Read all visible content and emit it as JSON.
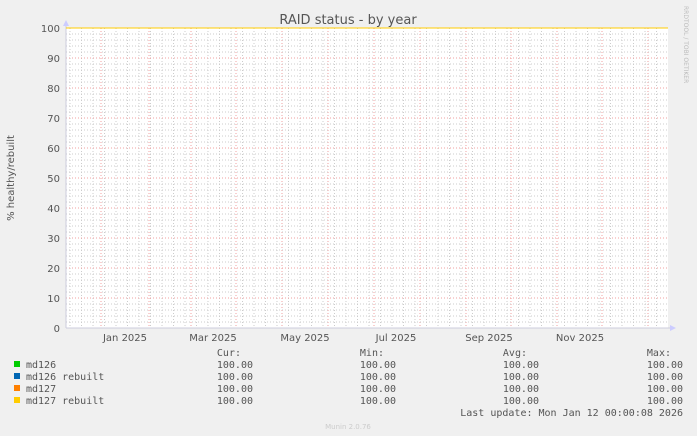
{
  "chart_data": {
    "type": "line",
    "title": "RAID status - by year",
    "ylabel": "% healthy/rebuilt",
    "xlabel": "",
    "ylim": [
      0,
      100
    ],
    "yticks": [
      0,
      10,
      20,
      30,
      40,
      50,
      60,
      70,
      80,
      90,
      100
    ],
    "xticks": [
      "Jan 2025",
      "Mar 2025",
      "May 2025",
      "Jul 2025",
      "Sep 2025",
      "Nov 2025"
    ],
    "grid": true,
    "series": [
      {
        "name": "md126",
        "color": "#00cc00",
        "values": [
          100,
          100
        ]
      },
      {
        "name": "md126 rebuilt",
        "color": "#0066b3",
        "values": [
          100,
          100
        ]
      },
      {
        "name": "md127",
        "color": "#ff8000",
        "values": [
          100,
          100
        ]
      },
      {
        "name": "md127 rebuilt",
        "color": "#ffcc00",
        "values": [
          100,
          100
        ]
      }
    ]
  },
  "legend": {
    "headers": [
      "Cur:",
      "Min:",
      "Avg:",
      "Max:"
    ],
    "rows": [
      {
        "name": "md126",
        "color": "#00cc00",
        "cur": "100.00",
        "min": "100.00",
        "avg": "100.00",
        "max": "100.00"
      },
      {
        "name": "md126 rebuilt",
        "color": "#0066b3",
        "cur": "100.00",
        "min": "100.00",
        "avg": "100.00",
        "max": "100.00"
      },
      {
        "name": "md127",
        "color": "#ff8000",
        "cur": "100.00",
        "min": "100.00",
        "avg": "100.00",
        "max": "100.00"
      },
      {
        "name": "md127 rebuilt",
        "color": "#ffcc00",
        "cur": "100.00",
        "min": "100.00",
        "avg": "100.00",
        "max": "100.00"
      }
    ]
  },
  "last_update": "Last update: Mon Jan 12 00:00:08 2026",
  "footer": "Munin 2.0.76",
  "watermark": "RRDTOOL / TOBI OETIKER"
}
